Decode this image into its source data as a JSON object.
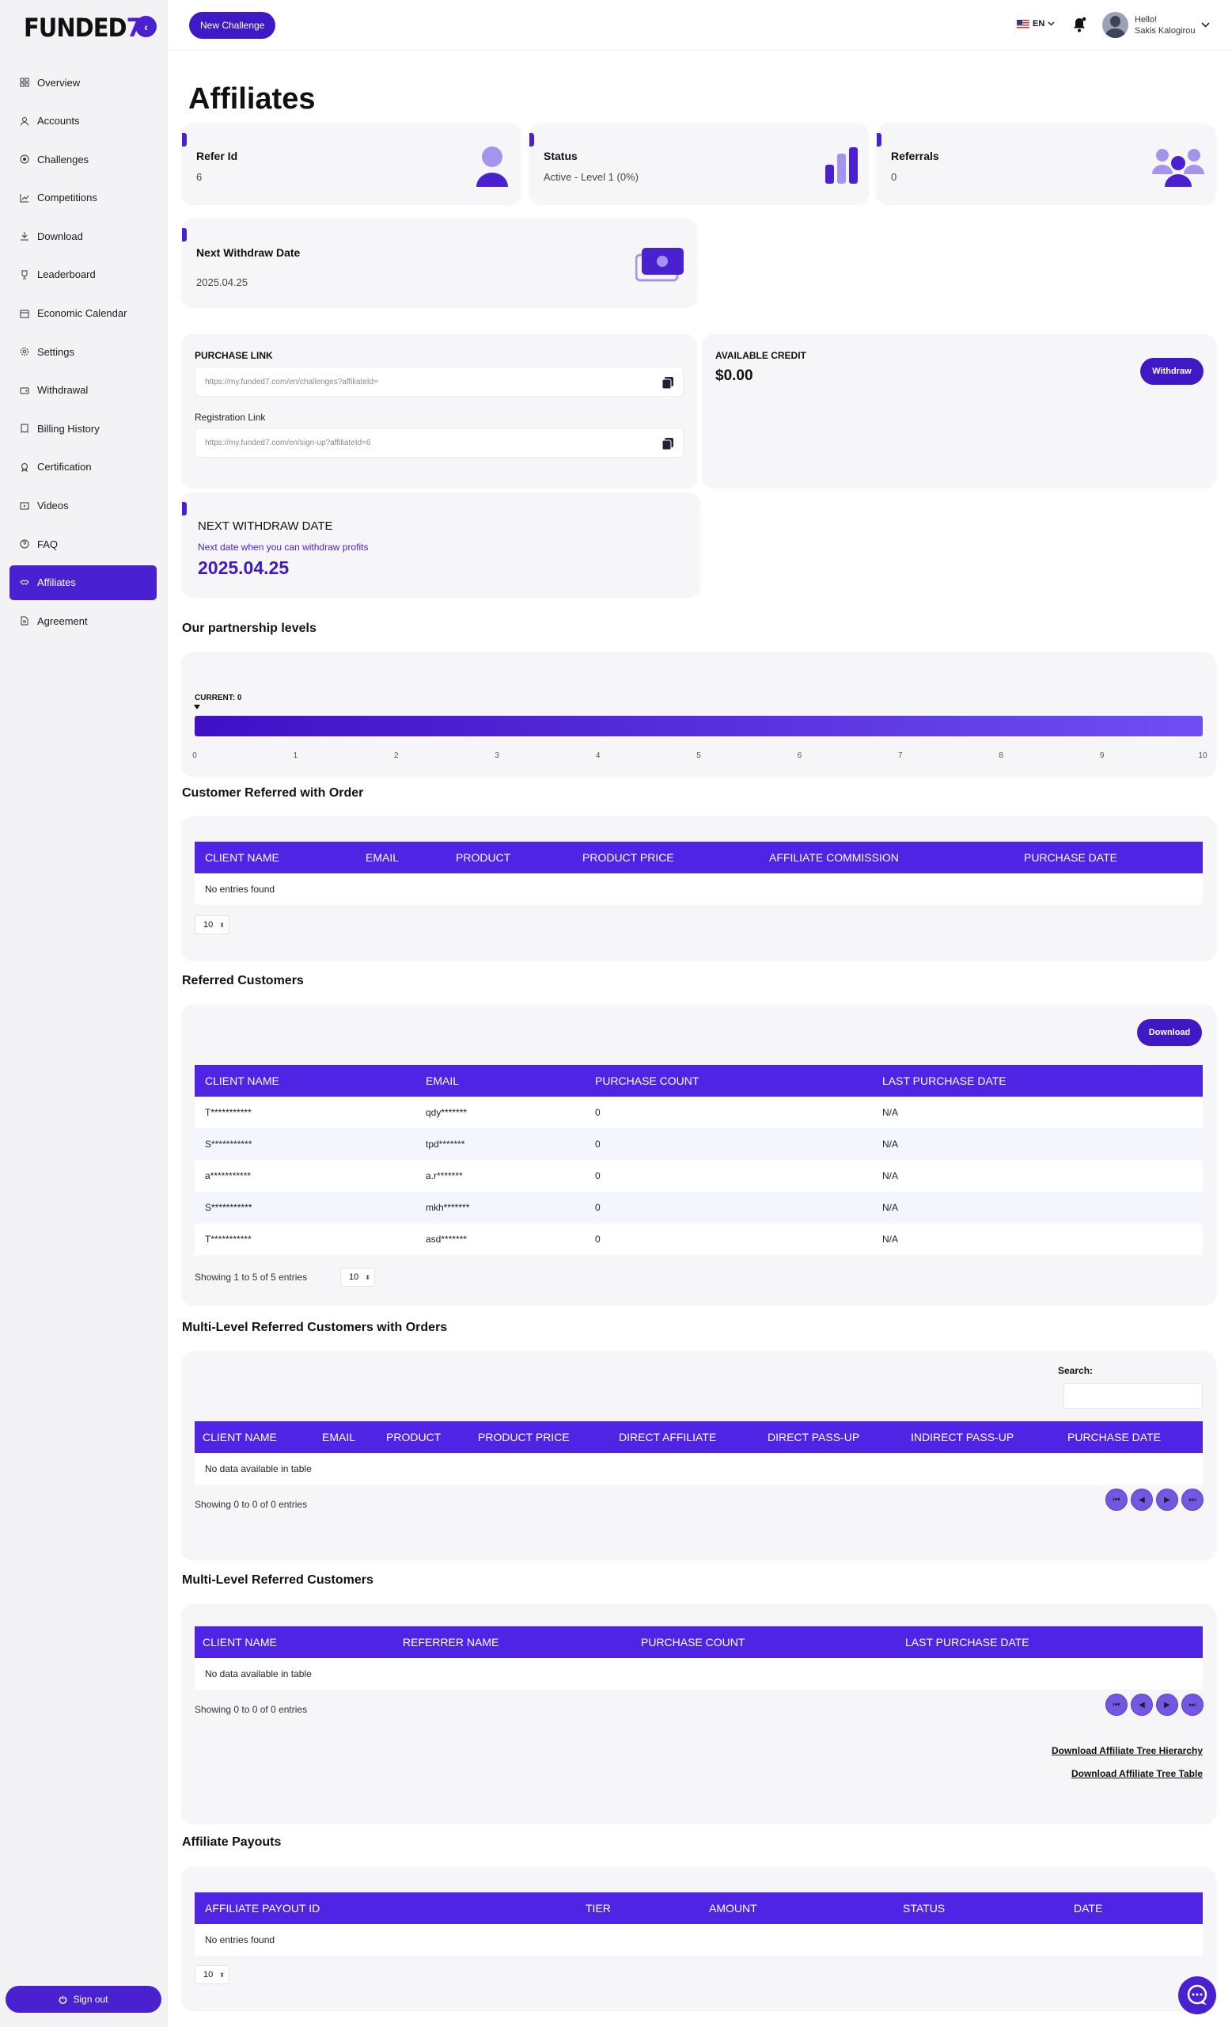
{
  "brand": {
    "name_left": "FUNDED",
    "name_right": "7"
  },
  "header": {
    "new_challenge_label": "New Challenge",
    "language": "EN",
    "greeting": "Hello!",
    "user_name": "Sakis Kalogirou"
  },
  "sidebar": {
    "items": [
      {
        "label": "Overview",
        "icon": "grid-icon"
      },
      {
        "label": "Accounts",
        "icon": "user-icon"
      },
      {
        "label": "Challenges",
        "icon": "target-icon"
      },
      {
        "label": "Competitions",
        "icon": "chart-icon"
      },
      {
        "label": "Download",
        "icon": "download-icon"
      },
      {
        "label": "Leaderboard",
        "icon": "trophy-icon"
      },
      {
        "label": "Economic Calendar",
        "icon": "calendar-icon"
      },
      {
        "label": "Settings",
        "icon": "gear-icon"
      },
      {
        "label": "Withdrawal",
        "icon": "wallet-icon"
      },
      {
        "label": "Billing History",
        "icon": "receipt-icon"
      },
      {
        "label": "Certification",
        "icon": "certificate-icon"
      },
      {
        "label": "Videos",
        "icon": "video-icon"
      },
      {
        "label": "FAQ",
        "icon": "question-icon"
      },
      {
        "label": "Affiliates",
        "icon": "handshake-icon"
      },
      {
        "label": "Agreement",
        "icon": "document-icon"
      }
    ],
    "active_index": 13,
    "sign_out_label": "Sign out"
  },
  "page": {
    "title": "Affiliates"
  },
  "stats": {
    "refer_id": {
      "title": "Refer Id",
      "value": "6"
    },
    "status": {
      "title": "Status",
      "value": "Active - Level 1 (0%)"
    },
    "referrals": {
      "title": "Referrals",
      "value": "0"
    },
    "next_withdraw": {
      "title": "Next Withdraw Date",
      "value": "2025.04.25"
    }
  },
  "links": {
    "purchase_label": "PURCHASE LINK",
    "purchase_url": "https://my.funded7.com/en/challenges?affiliateId=",
    "registration_label": "Registration Link",
    "registration_url": "https://my.funded7.com/en/sign-up?affiliateId=6"
  },
  "credit": {
    "label": "AVAILABLE CREDIT",
    "amount": "$0.00",
    "withdraw_label": "Withdraw"
  },
  "withdraw_date": {
    "title": "NEXT WITHDRAW DATE",
    "subtitle": "Next date when you can withdraw profits",
    "date": "2025.04.25"
  },
  "partnership": {
    "title": "Our partnership levels",
    "current_label": "CURRENT: 0",
    "current_level": 0,
    "ticks": [
      "0",
      "1",
      "2",
      "3",
      "4",
      "5",
      "6",
      "7",
      "8",
      "9",
      "10"
    ]
  },
  "customer_referred_orders": {
    "title": "Customer Referred with Order",
    "columns": [
      "CLIENT NAME",
      "EMAIL",
      "PRODUCT",
      "PRODUCT PRICE",
      "AFFILIATE COMMISSION",
      "PURCHASE DATE"
    ],
    "empty": "No entries found",
    "page_size": "10"
  },
  "referred_customers": {
    "title": "Referred Customers",
    "download_label": "Download",
    "columns": [
      "CLIENT NAME",
      "EMAIL",
      "PURCHASE COUNT",
      "LAST PURCHASE DATE"
    ],
    "rows": [
      [
        "T***********",
        "qdy*******",
        "0",
        "N/A"
      ],
      [
        "S***********",
        "tpd*******",
        "0",
        "N/A"
      ],
      [
        "a***********",
        "a.r*******",
        "0",
        "N/A"
      ],
      [
        "S***********",
        "mkh*******",
        "0",
        "N/A"
      ],
      [
        "T***********",
        "asd*******",
        "0",
        "N/A"
      ]
    ],
    "showing": "Showing 1 to 5 of 5 entries",
    "page_size": "10"
  },
  "multi_level_orders": {
    "title": "Multi-Level Referred Customers with Orders",
    "search_label": "Search:",
    "search_value": "",
    "columns": [
      "CLIENT NAME",
      "EMAIL",
      "PRODUCT",
      "PRODUCT PRICE",
      "DIRECT AFFILIATE",
      "DIRECT PASS-UP",
      "INDIRECT PASS-UP",
      "PURCHASE DATE"
    ],
    "empty": "No data available in table",
    "showing": "Showing 0 to 0 of 0 entries"
  },
  "multi_level_customers": {
    "title": "Multi-Level Referred Customers",
    "columns": [
      "CLIENT NAME",
      "REFERRER NAME",
      "PURCHASE COUNT",
      "LAST PURCHASE DATE"
    ],
    "empty": "No data available in table",
    "showing": "Showing 0 to 0 of 0 entries",
    "download_tree_hierarchy": "Download Affiliate Tree Hierarchy",
    "download_tree_table": "Download Affiliate Tree Table"
  },
  "affiliate_payouts": {
    "title": "Affiliate Payouts",
    "columns": [
      "AFFILIATE PAYOUT ID",
      "TIER",
      "AMOUNT",
      "STATUS",
      "DATE"
    ],
    "empty": "No entries found",
    "page_size": "10"
  },
  "colors": {
    "primary": "#4a21d0",
    "table_header": "#4f24e4",
    "page_bg": "#ffffff",
    "card_bg": "#f6f6f8"
  }
}
